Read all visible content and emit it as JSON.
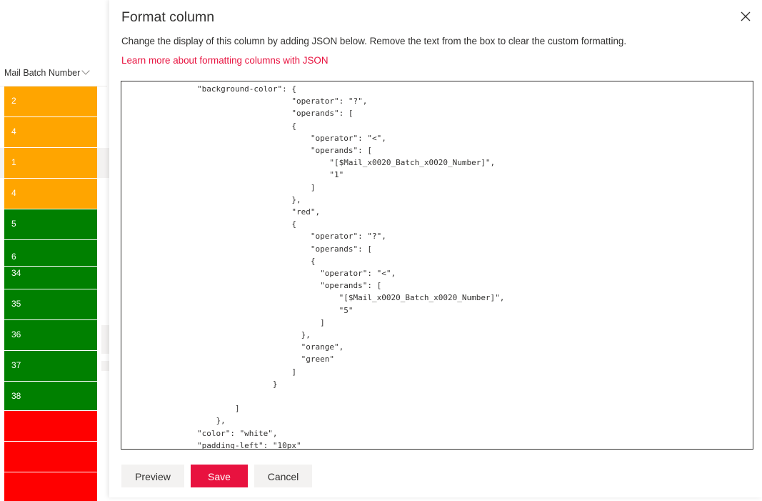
{
  "list": {
    "column_header": "Mail Batch Number",
    "cells": [
      {
        "value": "2",
        "color": "#ffa500"
      },
      {
        "value": "4",
        "color": "#ffa500"
      },
      {
        "value": "1",
        "color": "#ffa500"
      },
      {
        "value": "4",
        "color": "#ffa500"
      },
      {
        "value": "5",
        "color": "#008000"
      },
      {
        "value": "6",
        "color": "#008000"
      },
      {
        "value": "34",
        "color": "#008000"
      },
      {
        "value": "35",
        "color": "#008000"
      },
      {
        "value": "36",
        "color": "#008000"
      },
      {
        "value": "37",
        "color": "#008000"
      },
      {
        "value": "38",
        "color": "#008000"
      },
      {
        "value": "",
        "color": "#ff0000"
      },
      {
        "value": "",
        "color": "#ff0000"
      },
      {
        "value": "",
        "color": "#ff0000"
      }
    ]
  },
  "panel": {
    "title": "Format column",
    "close_icon": "close-icon",
    "description": "Change the display of this column by adding JSON below. Remove the text from the box to clear the custom formatting.",
    "learn_more_link": "Learn more about formatting columns with JSON",
    "json_text": "                \"background-color\": {\n                                    \"operator\": \"?\",\n                                    \"operands\": [\n                                    {\n                                        \"operator\": \"<\",\n                                        \"operands\": [\n                                            \"[$Mail_x0020_Batch_x0020_Number]\",\n                                            \"1\"\n                                        ]\n                                    },\n                                    \"red\",\n                                    {\n                                        \"operator\": \"?\",\n                                        \"operands\": [\n                                        {\n                                          \"operator\": \"<\",\n                                          \"operands\": [\n                                              \"[$Mail_x0020_Batch_x0020_Number]\",\n                                              \"5\"\n                                          ]\n                                      },\n                                      \"orange\",\n                                      \"green\"\n                                    ]\n                                }\n\n                        ]\n                    },\n                \"color\": \"white\",\n                \"padding-left\": \"10px\"",
    "buttons": {
      "preview": "Preview",
      "save": "Save",
      "cancel": "Cancel"
    }
  },
  "colors": {
    "accent": "#e8123f",
    "orange": "#ffa500",
    "green": "#008000",
    "red": "#ff0000"
  }
}
